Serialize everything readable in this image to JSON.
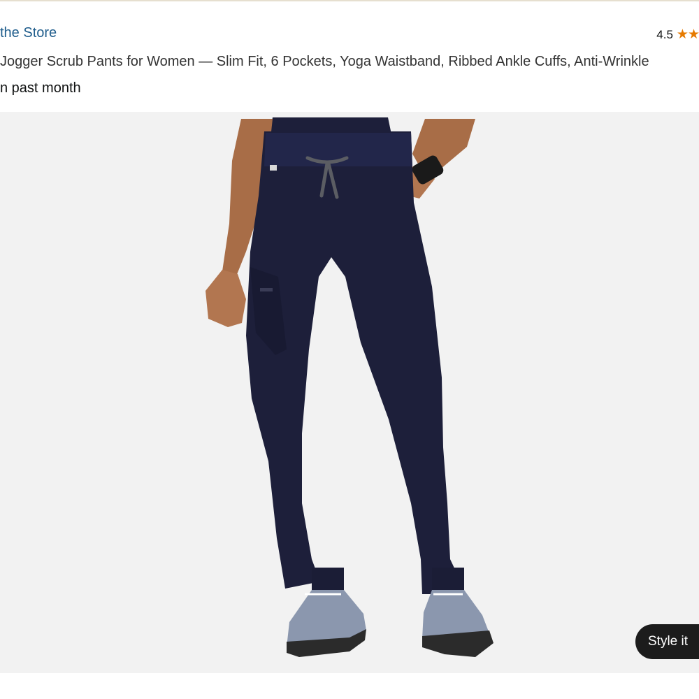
{
  "header": {
    "store_link": "the Store",
    "rating_value": "4.5",
    "rating_stars": "★★"
  },
  "product": {
    "title": "Jogger Scrub Pants for Women — Slim Fit, 6 Pockets, Yoga Waistband, Ribbed Ankle Cuffs, Anti-Wrinkle",
    "sales_line": "n past month"
  },
  "image": {
    "background_color": "#f2f2f2",
    "pants_color": "#1d1f3a",
    "drawstring_color": "#5b5d63"
  },
  "overlay": {
    "style_it_label": "Style it"
  },
  "colors": {
    "link": "#1f5d8c",
    "star": "#e67a00"
  }
}
